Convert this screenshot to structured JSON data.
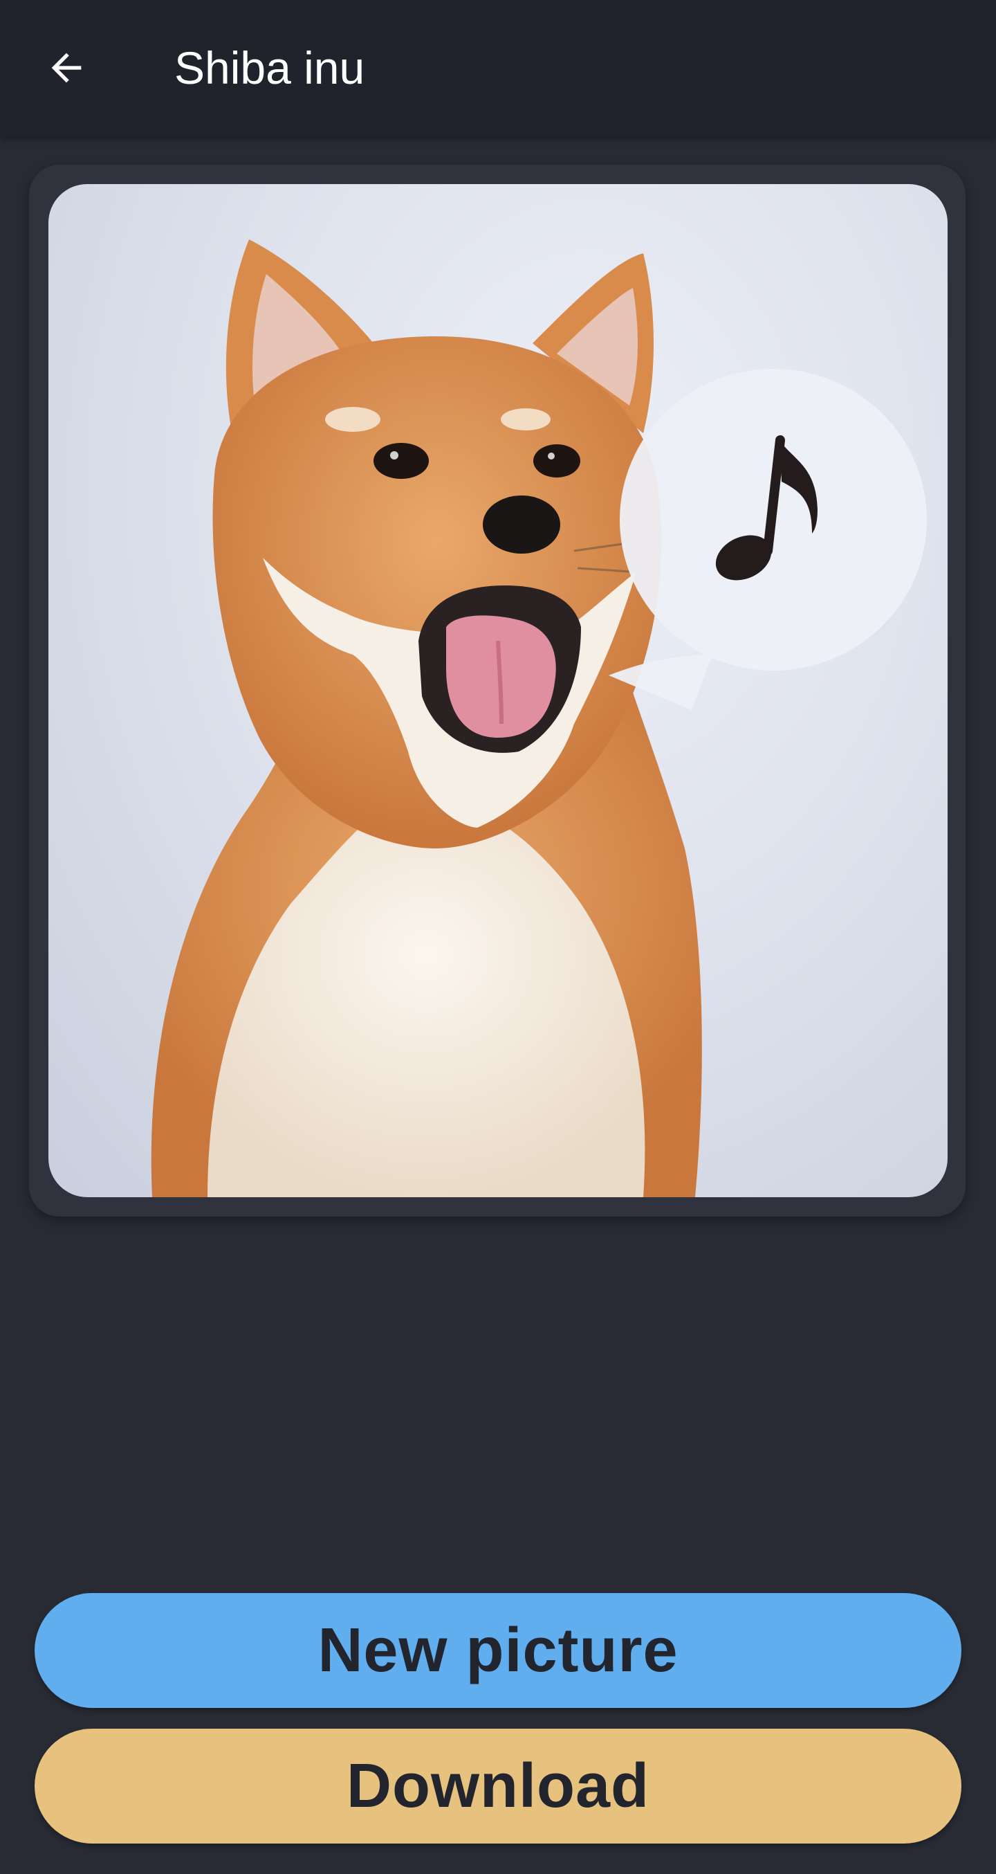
{
  "appbar": {
    "title": "Shiba inu",
    "back_icon": "arrow-left-icon"
  },
  "photo": {
    "subject": "shiba-inu-dog",
    "speech_bubble_icon": "music-note-icon"
  },
  "actions": {
    "new_picture_label": "New picture",
    "download_label": "Download"
  },
  "colors": {
    "appbar_bg": "#20232b",
    "page_bg": "#282b34",
    "card_bg": "#30333d",
    "new_picture_button": "#61aeee",
    "download_button": "#e6c27e",
    "button_text": "#22252d"
  }
}
